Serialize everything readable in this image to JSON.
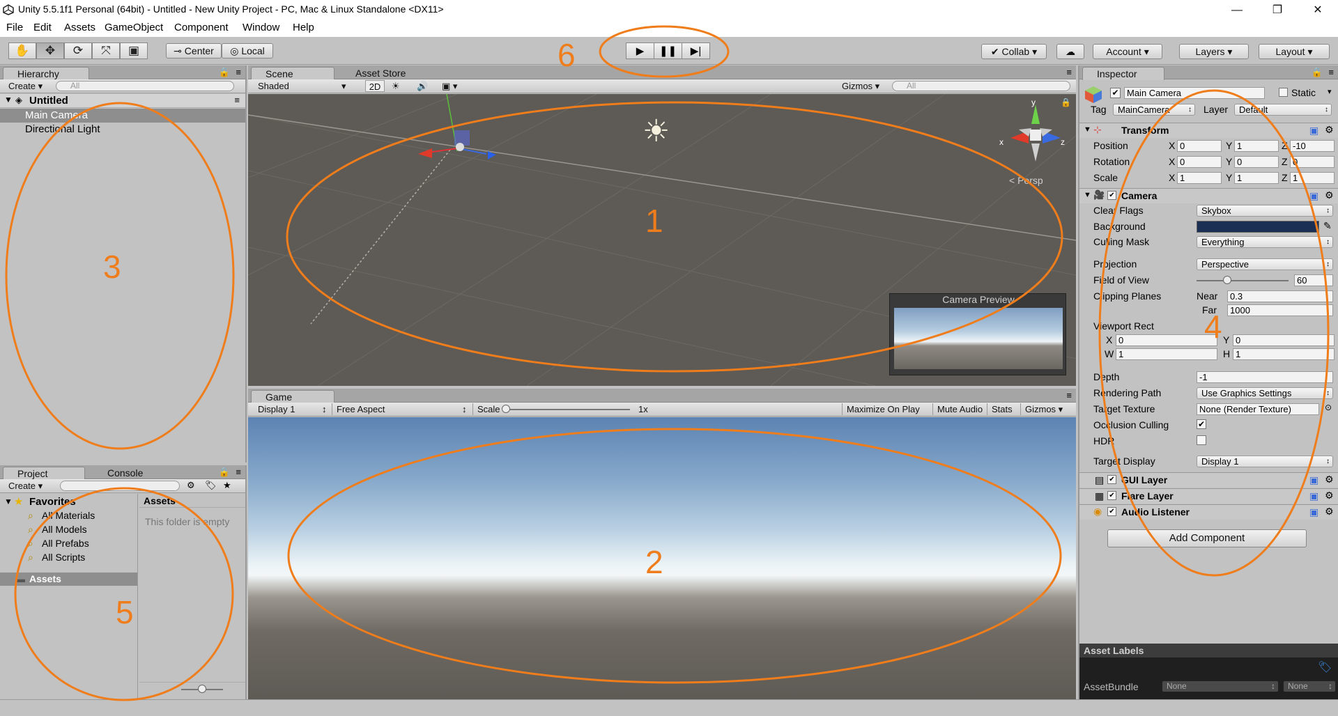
{
  "window": {
    "title": "Unity 5.5.1f1 Personal (64bit) - Untitled - New Unity Project - PC, Mac & Linux Standalone <DX11>",
    "minimize": "—",
    "restore": "❐",
    "close": "✕"
  },
  "menu": [
    "File",
    "Edit",
    "Assets",
    "GameObject",
    "Component",
    "Window",
    "Help"
  ],
  "toolbar": {
    "tools": [
      "hand-tool-icon",
      "move-tool-icon",
      "rotate-tool-icon",
      "scale-tool-icon",
      "rect-tool-icon"
    ],
    "pivot": "Center",
    "space": "Local",
    "play": "▶",
    "pause": "❚❚",
    "step": "▶|",
    "collab": "Collab ▾",
    "account": "Account",
    "layers": "Layers",
    "layout": "Layout"
  },
  "hierarchy": {
    "tab": "Hierarchy",
    "create": "Create",
    "search_placeholder": "All",
    "scene": "Untitled",
    "items": [
      "Main Camera",
      "Directional Light"
    ]
  },
  "scene": {
    "tabs": [
      "Scene",
      "Asset Store"
    ],
    "shading": "Shaded",
    "mode2d": "2D",
    "gizmos": "Gizmos",
    "search_placeholder": "All",
    "persp": "< Persp",
    "axis_x": "x",
    "axis_y": "y",
    "axis_z": "z",
    "camera_preview": "Camera Preview"
  },
  "game": {
    "tab": "Game",
    "display": "Display 1",
    "aspect": "Free Aspect",
    "scale_label": "Scale",
    "scale_value": "1x",
    "maximize": "Maximize On Play",
    "mute": "Mute Audio",
    "stats": "Stats",
    "gizmos": "Gizmos"
  },
  "project": {
    "tabs": [
      "Project",
      "Console"
    ],
    "create": "Create",
    "favorites": "Favorites",
    "fav_items": [
      "All Materials",
      "All Models",
      "All Prefabs",
      "All Scripts"
    ],
    "assets": "Assets",
    "assets_header": "Assets",
    "empty": "This folder is empty"
  },
  "inspector": {
    "tab": "Inspector",
    "name": "Main Camera",
    "static": "Static",
    "tag_label": "Tag",
    "tag": "MainCamera",
    "layer_label": "Layer",
    "layer": "Default",
    "transform": {
      "title": "Transform",
      "rows": [
        {
          "label": "Position",
          "x": "0",
          "y": "1",
          "z": "-10"
        },
        {
          "label": "Rotation",
          "x": "0",
          "y": "0",
          "z": "0"
        },
        {
          "label": "Scale",
          "x": "1",
          "y": "1",
          "z": "1"
        }
      ]
    },
    "camera": {
      "title": "Camera",
      "clear_flags_label": "Clear Flags",
      "clear_flags": "Skybox",
      "background_label": "Background",
      "background_color": "#1b2f55",
      "culling_mask_label": "Culling Mask",
      "culling_mask": "Everything",
      "projection_label": "Projection",
      "projection": "Perspective",
      "fov_label": "Field of View",
      "fov": "60",
      "fov_fraction": 0.33,
      "clipping_label": "Clipping Planes",
      "near_label": "Near",
      "near": "0.3",
      "far_label": "Far",
      "far": "1000",
      "viewport_label": "Viewport Rect",
      "vx": "0",
      "vy": "0",
      "vw": "1",
      "vh": "1",
      "depth_label": "Depth",
      "depth": "-1",
      "rendering_label": "Rendering Path",
      "rendering": "Use Graphics Settings",
      "target_texture_label": "Target Texture",
      "target_texture": "None (Render Texture)",
      "occlusion_label": "Occlusion Culling",
      "hdr_label": "HDR",
      "target_display_label": "Target Display",
      "target_display": "Display 1"
    },
    "components": [
      "GUI Layer",
      "Flare Layer",
      "Audio Listener"
    ],
    "add_component": "Add Component",
    "asset_labels": "Asset Labels",
    "assetbundle_label": "AssetBundle",
    "assetbundle": "None",
    "assetbundle_variant": "None"
  },
  "annotations": [
    "1",
    "2",
    "3",
    "4",
    "5",
    "6"
  ],
  "colors": {
    "annotation": "#ef7d1c",
    "panel_bg": "#c2c2c2",
    "scene_bg": "#5e5a55",
    "selection": "#8e8e8e"
  }
}
